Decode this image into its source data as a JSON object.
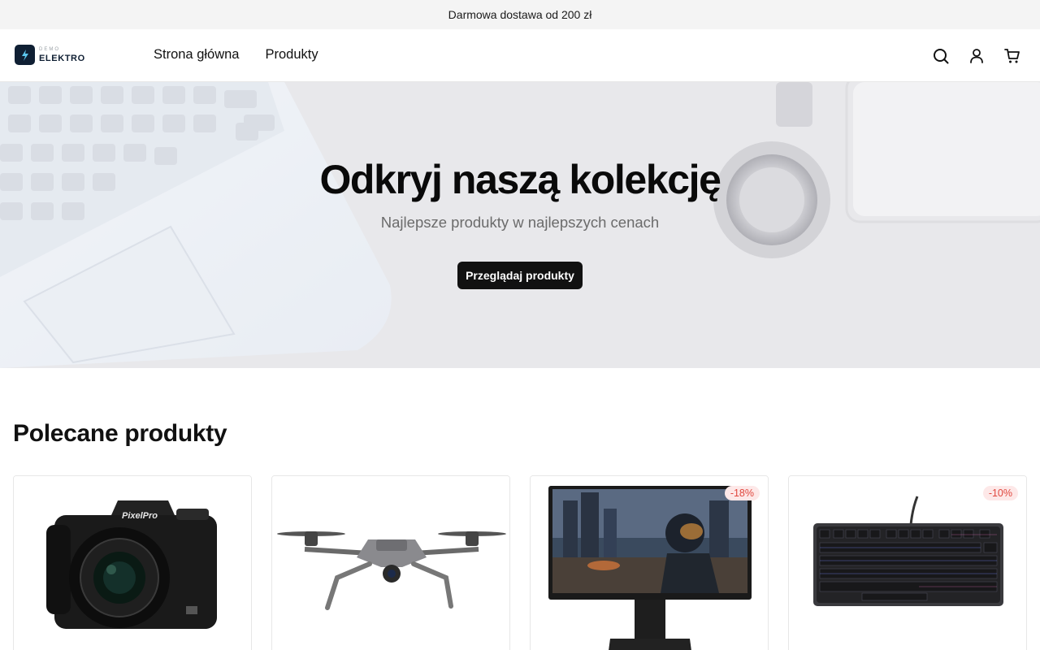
{
  "announcement": "Darmowa dostawa od 200 zł",
  "brand": {
    "small": "DEMO",
    "name": "ELEKTRO"
  },
  "nav": {
    "home": "Strona główna",
    "products": "Produkty"
  },
  "header_icons": [
    "search-icon",
    "user-icon",
    "cart-icon"
  ],
  "hero": {
    "title": "Odkryj naszą kolekcję",
    "subtitle": "Najlepsze produkty w najlepszych cenach",
    "cta": "Przeglądaj produkty"
  },
  "featured": {
    "title": "Polecane produkty",
    "products": [
      {
        "image": "camera",
        "brand_label": "PixelPro",
        "badge": ""
      },
      {
        "image": "drone",
        "badge": ""
      },
      {
        "image": "monitor",
        "badge": "-18%"
      },
      {
        "image": "keyboard",
        "badge": "-10%"
      }
    ]
  },
  "colors": {
    "accent": "#111111",
    "topbar": "#f4f4f4",
    "badge_bg": "#fde8e8",
    "badge_text": "#e0473e",
    "logo": "#0f1f33"
  }
}
